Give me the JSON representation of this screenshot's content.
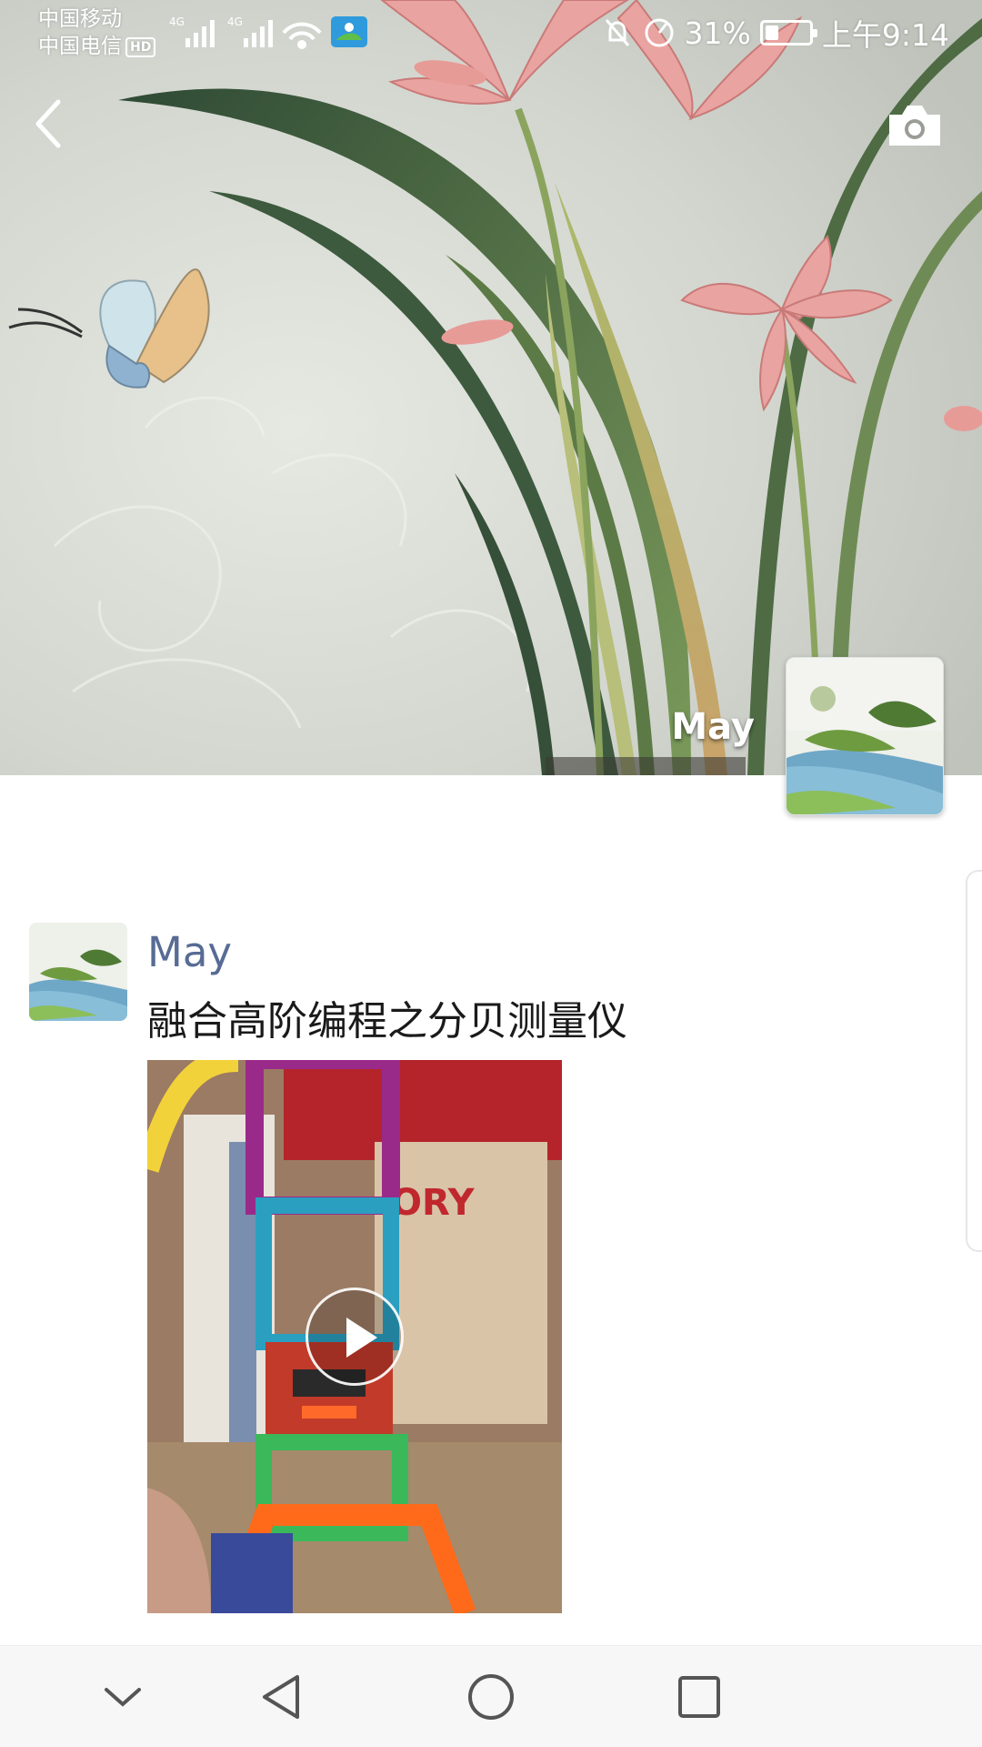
{
  "status_bar": {
    "carrier_1": "中国移动",
    "carrier_2": "中国电信",
    "hd_badge": "HD",
    "network_1": "4G",
    "network_2": "4G",
    "battery_percent": "31%",
    "battery_level": 0.31,
    "time": "上午9:14",
    "icons": [
      "signal-icon",
      "wifi-icon",
      "app-notification-icon",
      "mute-icon",
      "data-saver-icon",
      "battery-icon"
    ]
  },
  "header": {
    "back_icon": "chevron-left-icon",
    "camera_icon": "camera-icon",
    "user_name": "May"
  },
  "posts": [
    {
      "author": "May",
      "text": "融合高阶编程之分贝测量仪",
      "media_type": "video",
      "media_icon": "play-icon"
    }
  ],
  "navbar": {
    "icons": [
      "hide-nav-icon",
      "back-triangle-icon",
      "home-circle-icon",
      "recents-square-icon"
    ]
  },
  "colors": {
    "name_link": "#576b95",
    "text": "#1a1a1a",
    "navbar_bg": "#f7f7f7",
    "page_bg": "#ffffff"
  }
}
